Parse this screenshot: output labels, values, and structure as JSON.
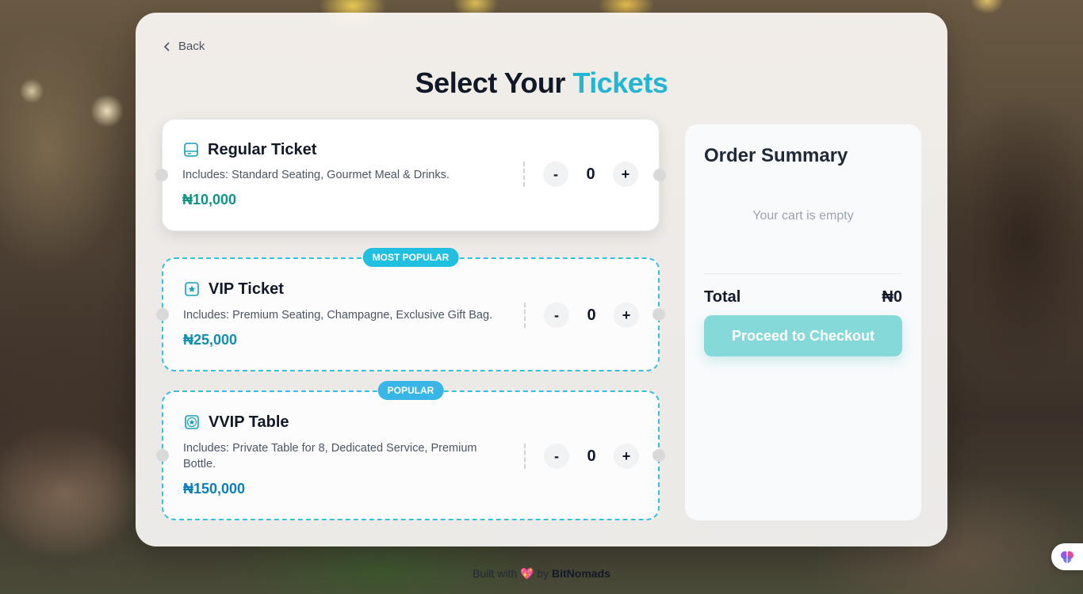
{
  "nav": {
    "back_label": "Back"
  },
  "header": {
    "title_main": "Select Your",
    "title_accent": "Tickets"
  },
  "tickets": [
    {
      "name": "Regular Ticket",
      "description": "Includes: Standard Seating, Gourmet Meal & Drinks.",
      "price": "₦10,000",
      "quantity": "0",
      "badge": "",
      "icon": "ticket-icon"
    },
    {
      "name": "VIP Ticket",
      "description": "Includes: Premium Seating, Champagne, Exclusive Gift Bag.",
      "price": "₦25,000",
      "quantity": "0",
      "badge": "MOST POPULAR",
      "icon": "star-ticket-icon"
    },
    {
      "name": "VVIP Table",
      "description": "Includes: Private Table for 8, Dedicated Service, Premium Bottle.",
      "price": "₦150,000",
      "quantity": "0",
      "badge": "POPULAR",
      "icon": "star-badge-icon"
    }
  ],
  "stepper": {
    "minus": "-",
    "plus": "+"
  },
  "summary": {
    "title": "Order Summary",
    "empty_text": "Your cart is empty",
    "total_label": "Total",
    "total_value": "₦0",
    "checkout_label": "Proceed to Checkout"
  },
  "footer": {
    "built_with": "Built with",
    "heart": "💖",
    "by": "by",
    "brand": "BitNomads"
  },
  "colors": {
    "accent": "#22b5d4",
    "price_regular": "#0d9488",
    "price_vip": "#0e8fae",
    "price_vvip": "#0b7fbb",
    "checkout_disabled": "#86d9d9"
  }
}
